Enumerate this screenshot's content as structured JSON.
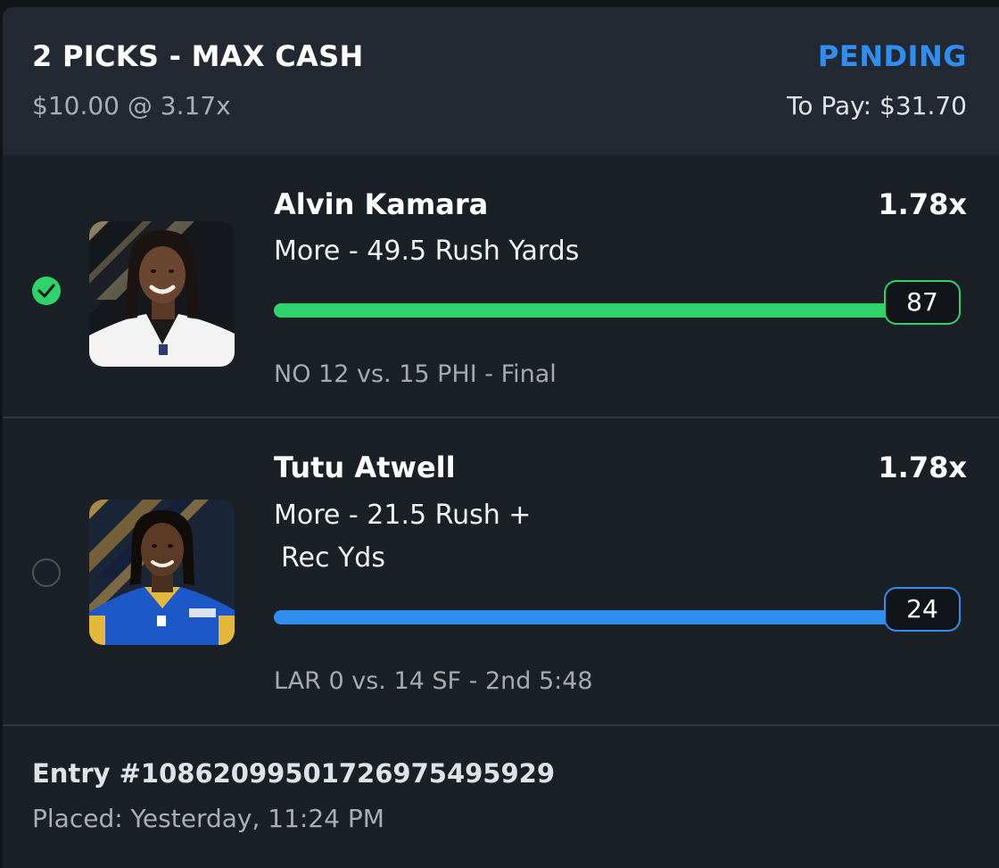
{
  "header": {
    "title": "2 PICKS - MAX CASH",
    "status": "PENDING",
    "wager": "$10.00 @ 3.17x",
    "to_pay": "To Pay: $31.70"
  },
  "picks": [
    {
      "player": "Alvin Kamara",
      "multiplier": "1.78x",
      "line": "More - 49.5 Rush Yards",
      "current_stat": "87",
      "progress": 1.0,
      "game": "NO 12 vs. 15 PHI  - Final",
      "status": "hit",
      "bar_color": "#2ed46a",
      "avatar_icon": "player-headshot-saints"
    },
    {
      "player": "Tutu Atwell",
      "multiplier": "1.78x",
      "line_1": "More - 21.5 Rush  +",
      "line_2": "Rec Yds",
      "current_stat": "24",
      "progress": 1.0,
      "game": "LAR 0 vs. 14 SF  - 2nd 5:48",
      "status": "pending",
      "bar_color": "#2f8ef0",
      "avatar_icon": "player-headshot-rams"
    }
  ],
  "footer": {
    "entry": "Entry #1086209950172697549592​9",
    "placed": "Placed: Yesterday, 11:24 PM"
  }
}
